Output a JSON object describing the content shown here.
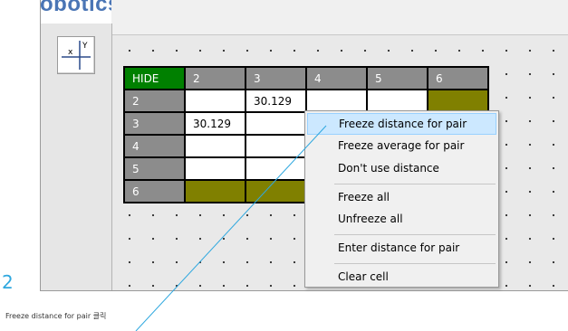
{
  "app": {
    "title_fragment": "obotics"
  },
  "toolbar": {
    "axis_button_icon": "xy-axis-icon"
  },
  "table": {
    "corner_label": "HIDE",
    "column_headers": [
      "2",
      "3",
      "4",
      "5",
      "6"
    ],
    "rows": [
      {
        "label": "2",
        "cells": [
          "",
          "30.129",
          "",
          "",
          ""
        ]
      },
      {
        "label": "3",
        "cells": [
          "30.129",
          "",
          "",
          "",
          ""
        ]
      },
      {
        "label": "4",
        "cells": [
          "",
          "",
          "",
          "",
          ""
        ]
      },
      {
        "label": "5",
        "cells": [
          "",
          "",
          "",
          "",
          ""
        ]
      },
      {
        "label": "6",
        "cells": [
          "",
          "",
          "",
          "",
          ""
        ]
      }
    ]
  },
  "context_menu": {
    "items": [
      {
        "label": "Freeze distance for pair",
        "highlighted": true
      },
      {
        "label": "Freeze average for pair"
      },
      {
        "label": "Don't use distance"
      },
      {
        "label": "Freeze all"
      },
      {
        "label": "Unfreeze all"
      },
      {
        "label": "Enter distance for pair"
      },
      {
        "label": "Clear cell"
      }
    ]
  },
  "annotation": {
    "step_number": "2",
    "caption": "Freeze distance for pair  클릭"
  },
  "colors": {
    "hide_cell": "#008000",
    "header_gray": "#8c8c8c",
    "olive": "#808000",
    "menu_highlight": "#cce8ff",
    "callout_line": "#2fa8df"
  }
}
